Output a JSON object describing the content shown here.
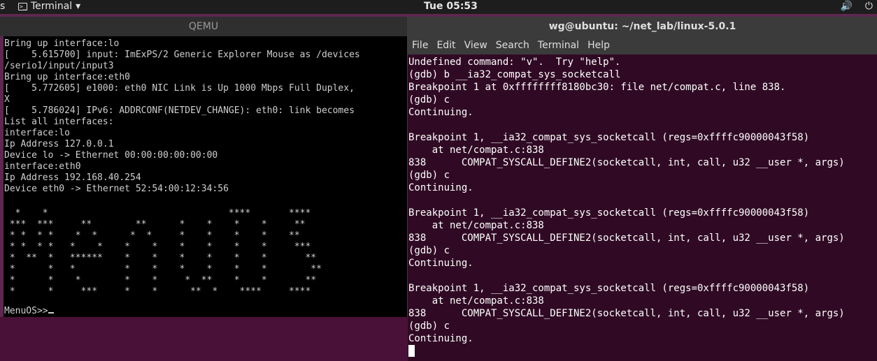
{
  "topbar": {
    "activities": "s",
    "app_label": "Terminal",
    "app_caret": "▾",
    "app_icon_glyph": ">_",
    "clock": "Tue 05:53",
    "volume_icon": "volume-icon",
    "power_icon": "power-icon",
    "volume_glyph": "🔊",
    "power_glyph": "⏻"
  },
  "qemu": {
    "title": "QEMU",
    "log_lines": [
      "Bring up interface:lo",
      "[    5.615700] input: ImExPS/2 Generic Explorer Mouse as /devices",
      "/serio1/input/input3",
      "Bring up interface:eth0",
      "[    5.772605] e1000: eth0 NIC Link is Up 1000 Mbps Full Duplex,",
      "X",
      "[    5.786024] IPv6: ADDRCONF(NETDEV_CHANGE): eth0: link becomes",
      "List all interfaces:",
      "interface:lo",
      "Ip Address 127.0.0.1",
      "Device lo -> Ethernet 00:00:00:00:00:00",
      "interface:eth0",
      "Ip Address 192.168.40.254",
      "Device eth0 -> Ethernet 52:54:00:12:34:56"
    ],
    "banner_lines": [
      "  *    *                                 ****       ****",
      " ***  ***     **        **      *    *    *    *     **",
      " * *  * *    *  *      *  *     *    *    *    *    **",
      " * *  * *   *    *    *    *    *    *    *    *     ***",
      " *  **  *   ******    *    *    *    *    *    *       **",
      " *      *   *         *    *    *    *    *    *        **",
      " *      *    *        *    *     *  **    *    *       **",
      " *      *     ***     *    *      **  *    ****     ****"
    ],
    "prompt": "MenuOS>>"
  },
  "terminal": {
    "title": "wg@ubuntu: ~/net_lab/linux-5.0.1",
    "menu": [
      "File",
      "Edit",
      "View",
      "Search",
      "Terminal",
      "Help"
    ],
    "lines": [
      "Undefined command: \"v\".  Try \"help\".",
      "(gdb) b __ia32_compat_sys_socketcall",
      "Breakpoint 1 at 0xffffffff8180bc30: file net/compat.c, line 838.",
      "(gdb) c",
      "Continuing.",
      "",
      "Breakpoint 1, __ia32_compat_sys_socketcall (regs=0xffffc90000043f58)",
      "    at net/compat.c:838",
      "838      COMPAT_SYSCALL_DEFINE2(socketcall, int, call, u32 __user *, args)",
      "(gdb) c",
      "Continuing.",
      "",
      "Breakpoint 1, __ia32_compat_sys_socketcall (regs=0xffffc90000043f58)",
      "    at net/compat.c:838",
      "838      COMPAT_SYSCALL_DEFINE2(socketcall, int, call, u32 __user *, args)",
      "(gdb) c",
      "Continuing.",
      "",
      "Breakpoint 1, __ia32_compat_sys_socketcall (regs=0xffffc90000043f58)",
      "    at net/compat.c:838",
      "838      COMPAT_SYSCALL_DEFINE2(socketcall, int, call, u32 __user *, args)",
      "(gdb) c",
      "Continuing."
    ]
  },
  "colors": {
    "desktop": "#5e2750",
    "terminal_bg": "#300a24",
    "qemu_bg": "#000000",
    "topbar_bg": "#1d1d1d"
  }
}
